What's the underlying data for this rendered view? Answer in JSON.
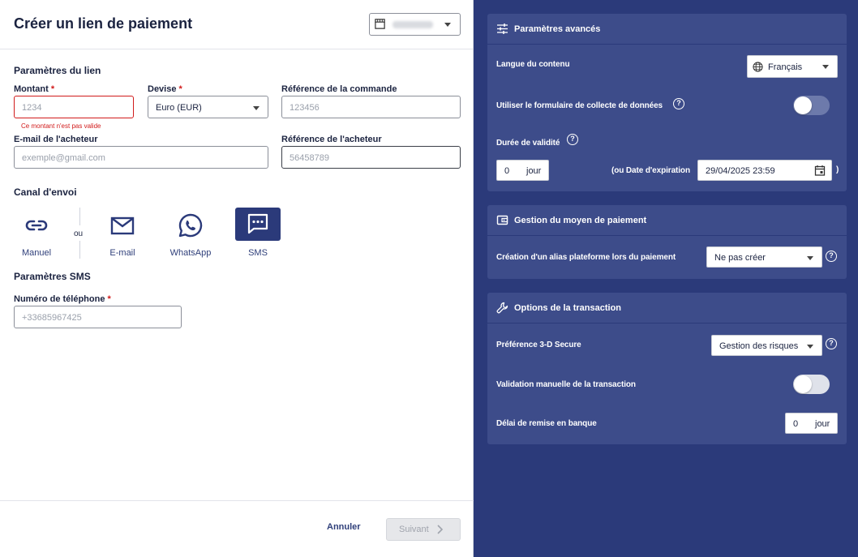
{
  "left": {
    "title": "Créer un lien de paiement",
    "shop_icon": "store-icon",
    "link_params": {
      "section_title": "Paramètres du lien",
      "amount": {
        "label": "Montant",
        "required": "*",
        "placeholder": "1234",
        "error": "Ce montant n'est pas valide"
      },
      "currency": {
        "label": "Devise",
        "required": "*",
        "value": "Euro (EUR)"
      },
      "order_ref": {
        "label": "Référence de la commande",
        "placeholder": "123456"
      },
      "buyer_email": {
        "label": "E-mail de l'acheteur",
        "placeholder": "exemple@gmail.com"
      },
      "buyer_ref": {
        "label": "Référence de l'acheteur",
        "placeholder": "56458789"
      }
    },
    "channel": {
      "section_title": "Canal d'envoi",
      "or_label": "ou",
      "items": [
        {
          "label": "Manuel",
          "icon": "link-icon"
        },
        {
          "label": "E-mail",
          "icon": "mail-icon"
        },
        {
          "label": "WhatsApp",
          "icon": "whatsapp-icon"
        },
        {
          "label": "SMS",
          "icon": "sms-icon",
          "active": true
        }
      ]
    },
    "sms": {
      "section_title": "Paramètres SMS",
      "phone": {
        "label": "Numéro de téléphone",
        "required": "*",
        "placeholder": "+33685967425"
      }
    },
    "footer": {
      "cancel_label": "Annuler",
      "next_label": "Suivant"
    }
  },
  "right": {
    "advanced": {
      "title": "Paramètres avancés",
      "icon": "sliders-icon",
      "language_label": "Langue du contenu",
      "language_value": "Français",
      "collect_form_label": "Utiliser le formulaire de collecte de données",
      "collect_form_enabled": false,
      "validity_label": "Durée de validité",
      "validity_value": "0",
      "validity_unit": "jour",
      "expiry_label": "(ou Date d'expiration",
      "expiry_value": "29/04/2025 23:59",
      "expiry_close": ")"
    },
    "payment": {
      "title": "Gestion du moyen de paiement",
      "icon": "wallet-icon",
      "alias_label": "Création d'un alias plateforme lors du paiement",
      "alias_value": "Ne pas créer"
    },
    "transaction": {
      "title": "Options de la transaction",
      "icon": "wrench-icon",
      "secure_label": "Préférence 3-D Secure",
      "secure_value": "Gestion des risques",
      "manual_label": "Validation manuelle de la transaction",
      "manual_enabled": false,
      "delay_label": "Délai de remise en banque",
      "delay_value": "0",
      "delay_unit": "jour"
    }
  },
  "colors": {
    "accent": "#2b3a7a",
    "card": "#3d4c8a",
    "error": "#d11b1b"
  }
}
